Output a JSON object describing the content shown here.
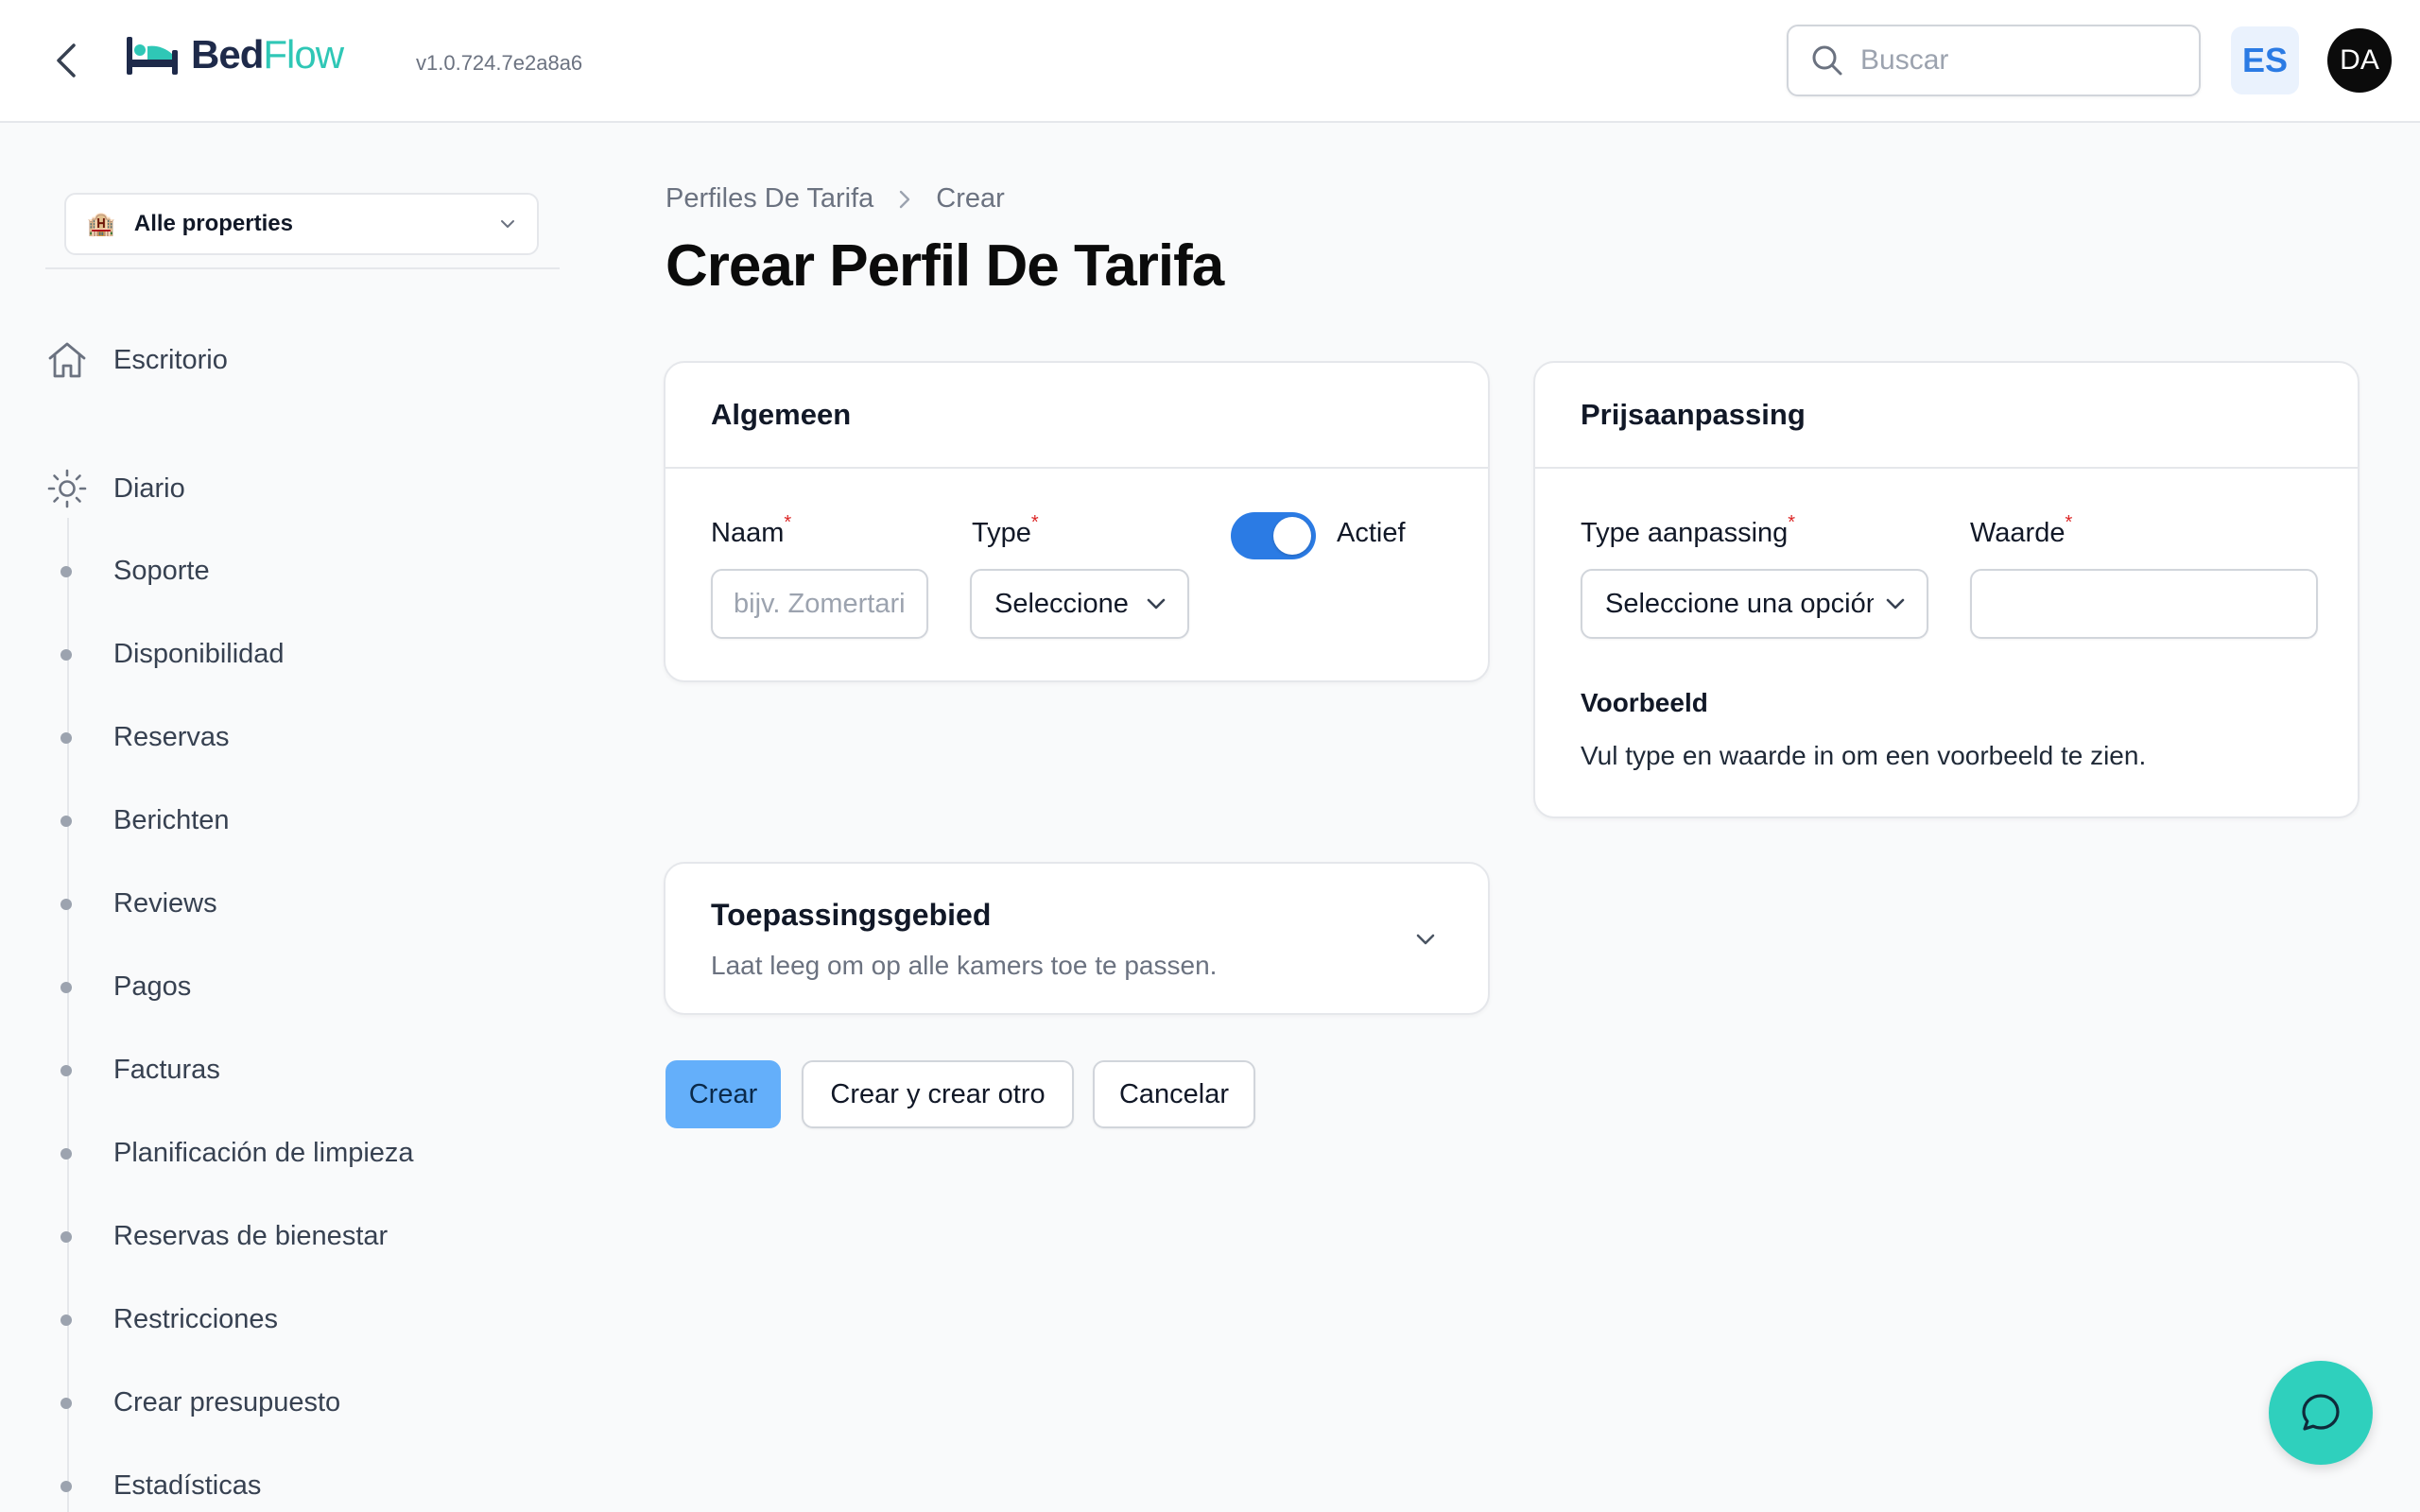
{
  "app": {
    "logo_part1": "Bed",
    "logo_part2": "Flow",
    "version": "v1.0.724.7e2a8a6",
    "search_placeholder": "Buscar",
    "language": "ES",
    "user_initials": "DA"
  },
  "sidebar": {
    "property_selector": "Alle properties",
    "top_items": [
      {
        "label": "Escritorio",
        "icon": "home-icon"
      },
      {
        "label": "Diario",
        "icon": "sun-icon"
      }
    ],
    "sub_items": [
      "Soporte",
      "Disponibilidad",
      "Reservas",
      "Berichten",
      "Reviews",
      "Pagos",
      "Facturas",
      "Planificación de limpieza",
      "Reservas de bienestar",
      "Restricciones",
      "Crear presupuesto",
      "Estadísticas"
    ]
  },
  "breadcrumb": {
    "parent": "Perfiles De Tarifa",
    "current": "Crear"
  },
  "page_title": "Crear Perfil De Tarifa",
  "general_card": {
    "title": "Algemeen",
    "name_label": "Naam",
    "name_placeholder": "bijv. Zomertarief",
    "type_label": "Type",
    "type_value": "Seleccione una opción",
    "active_label": "Actief",
    "active": true
  },
  "price_card": {
    "title": "Prijsaanpassing",
    "adjust_type_label": "Type aanpassing",
    "adjust_type_value": "Seleccione una opción",
    "value_label": "Waarde",
    "value": "",
    "preview_title": "Voorbeeld",
    "preview_text": "Vul type en waarde in om een voorbeeld te zien."
  },
  "scope_card": {
    "title": "Toepassingsgebied",
    "subtitle": "Laat leeg om op alle kamers toe te passen."
  },
  "actions": {
    "create": "Crear",
    "create_another": "Crear y crear otro",
    "cancel": "Cancelar"
  },
  "colors": {
    "primary": "#2b7be4",
    "primary_button": "#64affa",
    "brand_dark": "#1e2a4a",
    "brand_teal": "#2fc7b6",
    "required": "#dc2626"
  }
}
